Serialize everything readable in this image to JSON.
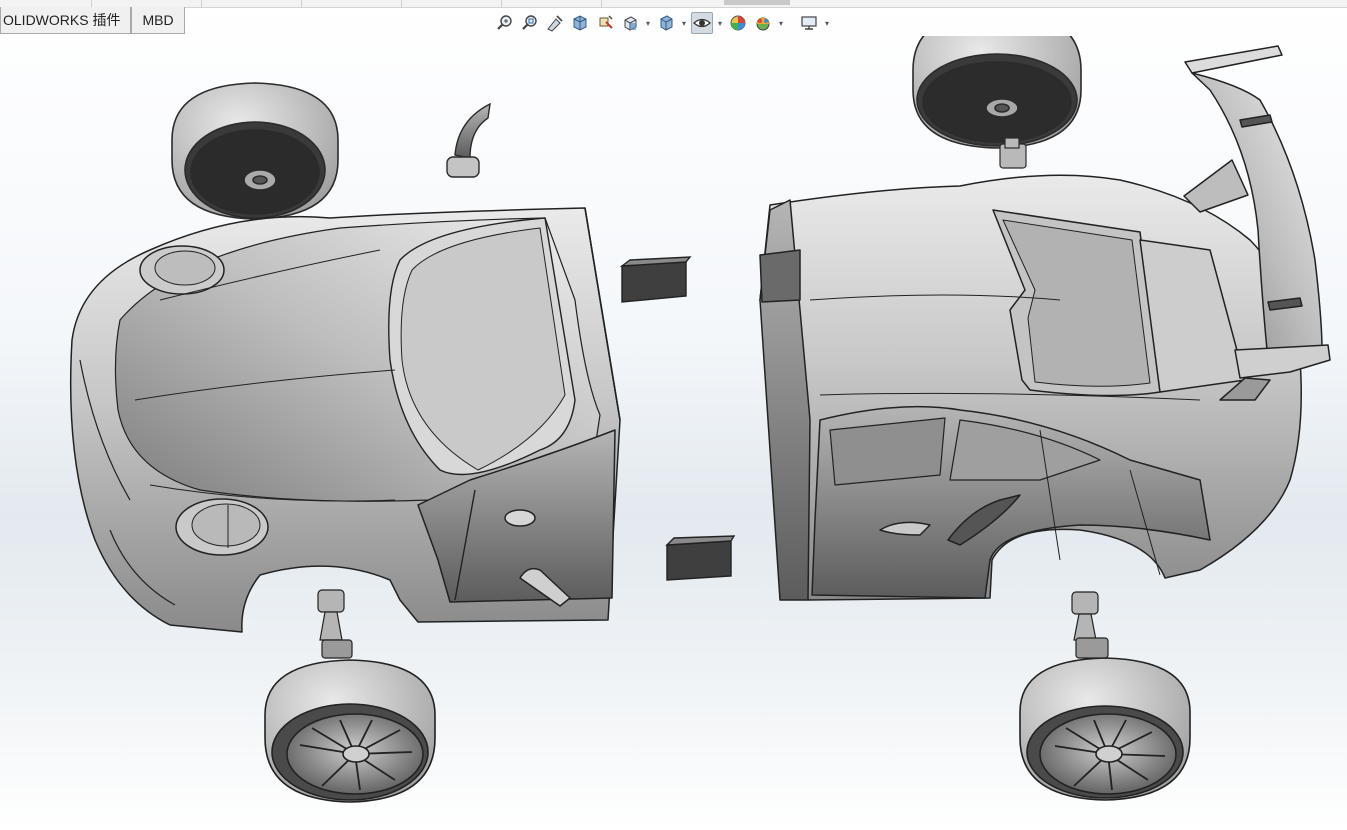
{
  "tabs": [
    {
      "label": "OLIDWORKS 插件"
    },
    {
      "label": "MBD"
    }
  ],
  "toolbar": {
    "icons": [
      "zoom-to-fit-icon",
      "zoom-to-area-icon",
      "previous-view-icon",
      "section-view-icon",
      "dynamic-annotation-icon",
      "view-orientation-icon",
      "display-style-icon",
      "hide-show-items-icon",
      "edit-appearance-icon",
      "apply-scene-icon",
      "view-settings-icon"
    ]
  },
  "colors": {
    "body_light": "#d6d6d6",
    "body_mid": "#a9a9a9",
    "body_dark": "#6e6e6e",
    "edge": "#2b2b2b",
    "viewport_bg": "#e6ebf0"
  }
}
